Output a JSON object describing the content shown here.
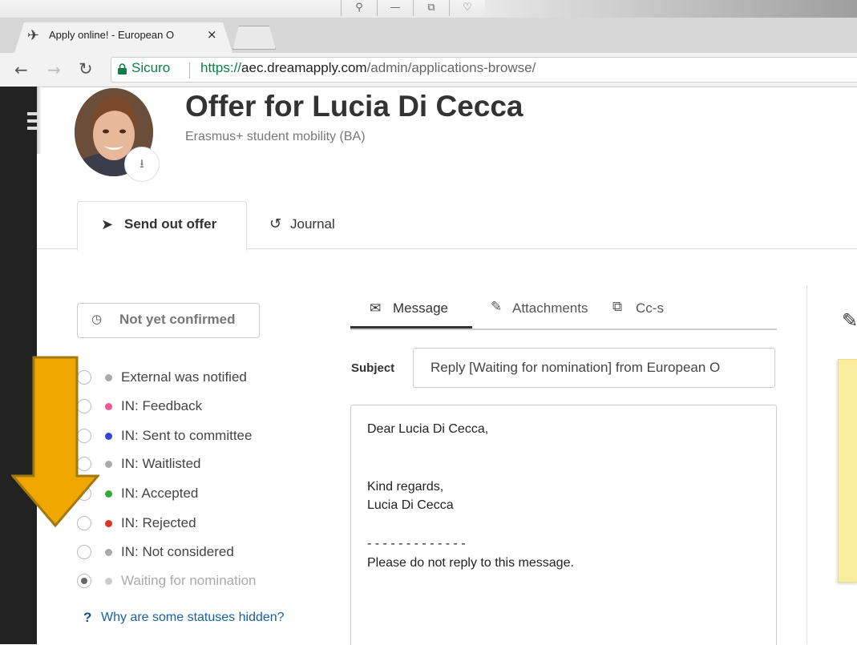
{
  "browser": {
    "tab_title": "Apply online! - European O",
    "tab_close": "×",
    "secure_label": "Sicuro",
    "url_scheme": "https://",
    "url_host": "aec.dreamapply.com",
    "url_path": "/admin/applications-browse/",
    "window_controls": [
      "⚲",
      "—",
      "⧉",
      "♡"
    ]
  },
  "header": {
    "title": "Offer for Lucia Di Cecca",
    "subtitle": "Erasmus+ student mobility (BA)"
  },
  "tabs": [
    {
      "label": "Send out offer",
      "icon": "paper-plane-icon",
      "active": true
    },
    {
      "label": "Journal",
      "icon": "history-icon",
      "active": false
    }
  ],
  "status": {
    "badge": "Not yet confirmed",
    "items": [
      {
        "label": "External was notified",
        "color": "#aaaaaa",
        "selected": false,
        "disabled": false
      },
      {
        "label": "IN: Feedback",
        "color": "#ee5595",
        "selected": false,
        "disabled": false
      },
      {
        "label": "IN: Sent to committee",
        "color": "#3344dd",
        "selected": false,
        "disabled": false
      },
      {
        "label": "IN: Waitlisted",
        "color": "#aaaaaa",
        "selected": false,
        "disabled": false
      },
      {
        "label": "IN: Accepted",
        "color": "#33aa33",
        "selected": false,
        "disabled": false
      },
      {
        "label": "IN: Rejected",
        "color": "#dd3322",
        "selected": false,
        "disabled": false
      },
      {
        "label": "IN: Not considered",
        "color": "#aaaaaa",
        "selected": false,
        "disabled": false
      },
      {
        "label": "Waiting for nomination",
        "color": "#cccccc",
        "selected": true,
        "disabled": true
      }
    ],
    "help_mark": "?",
    "help_link": "Why are some statuses hidden?"
  },
  "compose": {
    "tabs": [
      {
        "label": "Message",
        "icon": "envelope-icon",
        "active": true
      },
      {
        "label": "Attachments",
        "icon": "paperclip-icon",
        "active": false
      },
      {
        "label": "Cc-s",
        "icon": "copy-icon",
        "active": false
      }
    ],
    "subject_label": "Subject",
    "subject_value": "Reply [Waiting for nomination] from European O",
    "body_lines": [
      "Dear Lucia Di Cecca,",
      "Kind regards,",
      "Lucia Di Cecca",
      "- - - - - - - - - - - - -",
      "Please do not reply to this message."
    ]
  },
  "colors": {
    "arrow": "#f0a800",
    "arrow_border": "#a07a10",
    "link": "#1a5fa6",
    "sidebar": "#222222",
    "note": "#fbeda0",
    "secure_green": "#0b8043"
  }
}
